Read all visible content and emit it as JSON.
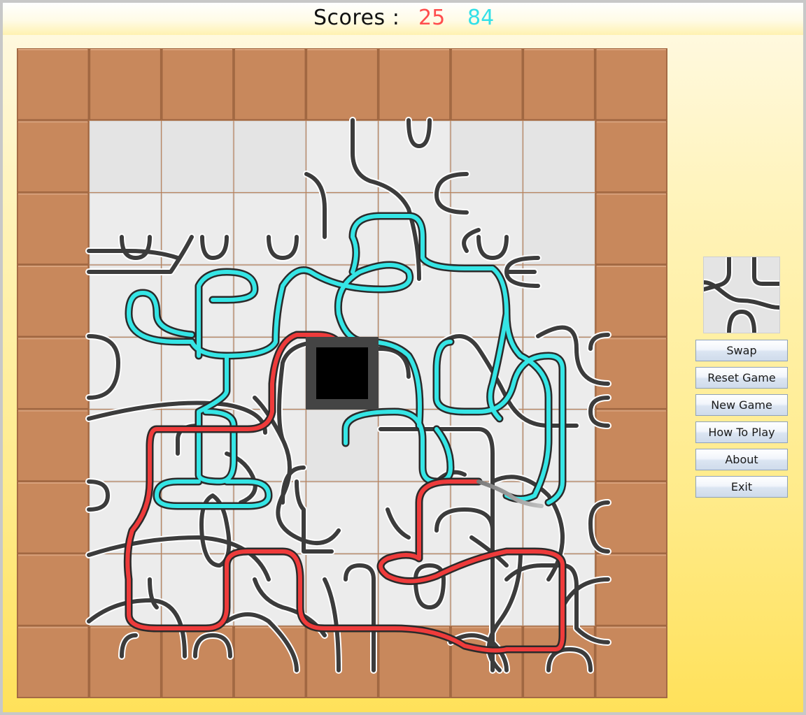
{
  "scores": {
    "label": "Scores :",
    "red": "25",
    "cyan": "84",
    "red_color": "#ff4d4d",
    "cyan_color": "#33e0e8"
  },
  "board": {
    "cols": 9,
    "rows": 9,
    "border_tile_color": "#c8885c",
    "empty_tile_color": "#e4e4e4",
    "center_tile": "black-square",
    "track_colors": {
      "neutral": "#3c3c3c",
      "red": "#ee3b3b",
      "cyan": "#35e5e5"
    }
  },
  "preview": {
    "label": "next-tile"
  },
  "buttons": {
    "swap": "Swap",
    "reset": "Reset Game",
    "new_game": "New Game",
    "how_to_play": "How To Play",
    "about": "About",
    "exit": "Exit"
  }
}
